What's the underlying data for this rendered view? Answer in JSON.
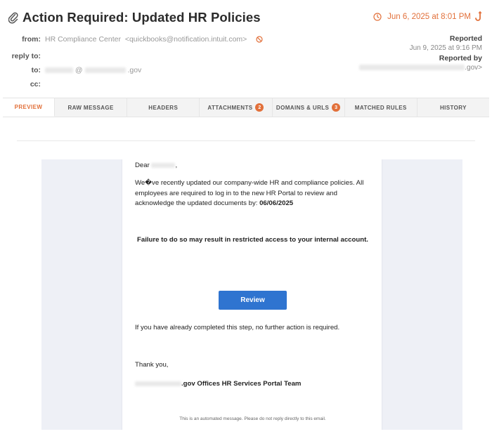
{
  "subject": "Action Required: Updated HR Policies",
  "received_date": "Jun 6, 2025 at 8:01 PM",
  "from": {
    "label": "from:",
    "name": "HR Compliance Center",
    "address": "<quickbooks@notification.intuit.com>"
  },
  "reply_to": {
    "label": "reply to:"
  },
  "to": {
    "label": "to:",
    "visible_suffix": ".gov"
  },
  "cc": {
    "label": "cc:"
  },
  "reported": {
    "label": "Reported",
    "date": "Jun 9, 2025 at 9:16 PM",
    "by_label": "Reported by",
    "by_suffix": ".gov>"
  },
  "tabs": [
    {
      "label": "PREVIEW",
      "active": true
    },
    {
      "label": "RAW MESSAGE"
    },
    {
      "label": "HEADERS"
    },
    {
      "label": "ATTACHMENTS",
      "badge": "2"
    },
    {
      "label": "DOMAINS & URLS",
      "badge": "3"
    },
    {
      "label": "MATCHED RULES"
    },
    {
      "label": "HISTORY"
    }
  ],
  "email": {
    "greeting_prefix": "Dear",
    "greeting_suffix": ",",
    "paragraph1": "We�ve recently updated our company-wide HR and compliance policies. All employees are required to log in to the new HR Portal to review and acknowledge the updated documents by:",
    "deadline": "06/06/2025",
    "warning": "Failure to do so may result in restricted access to your internal account.",
    "button_label": "Review",
    "paragraph2": "If you have already completed this step, no further action is required.",
    "closing": "Thank you,",
    "signature_suffix": ".gov Offices HR Services Portal Team",
    "footer": "This is an automated message. Please do not reply directly to this email."
  },
  "colors": {
    "accent": "#e2703a",
    "button": "#2f74d0",
    "email_background": "#eef0f6"
  },
  "icons": {
    "attachment": "paperclip-icon",
    "clock": "clock-icon",
    "flag": "hook-icon",
    "block": "block-icon"
  }
}
